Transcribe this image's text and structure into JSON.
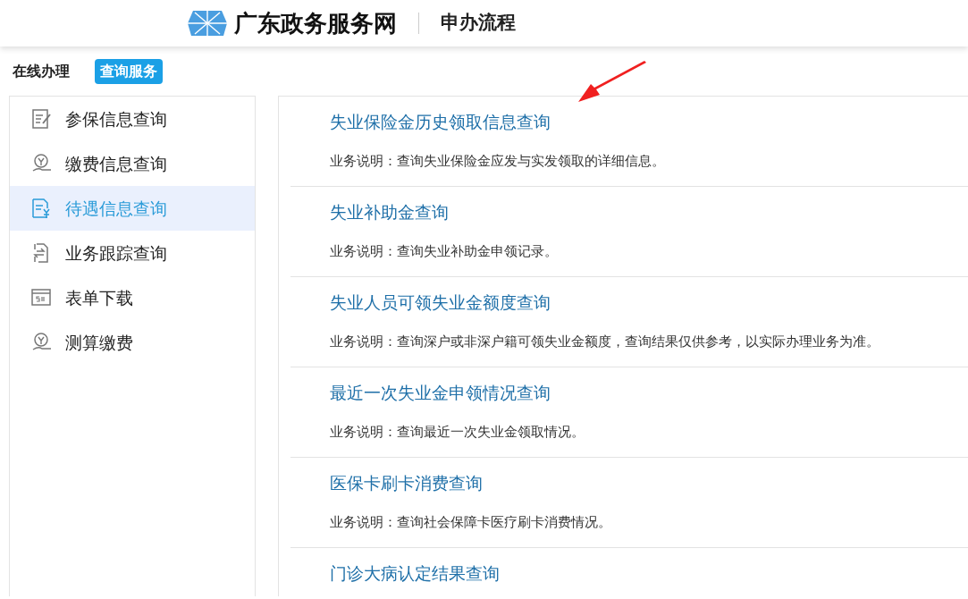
{
  "header": {
    "site_name": "广东政务服务网",
    "page_title": "申办流程"
  },
  "tabs": [
    {
      "label": "在线办理",
      "selected": false
    },
    {
      "label": "查询服务",
      "selected": true
    }
  ],
  "sidebar": {
    "items": [
      {
        "label": "参保信息查询",
        "kind": "form",
        "selected": false
      },
      {
        "label": "缴费信息查询",
        "kind": "coin",
        "selected": false
      },
      {
        "label": "待遇信息查询",
        "kind": "yen",
        "selected": true
      },
      {
        "label": "业务跟踪查询",
        "kind": "transfer",
        "selected": false
      },
      {
        "label": "表单下载",
        "kind": "si",
        "selected": false
      },
      {
        "label": "测算缴费",
        "kind": "coin",
        "selected": false
      }
    ]
  },
  "services": [
    {
      "title": "失业保险金历史领取信息查询",
      "description": "业务说明：查询失业保险金应发与实发领取的详细信息。"
    },
    {
      "title": "失业补助金查询",
      "description": "业务说明：查询失业补助金申领记录。"
    },
    {
      "title": "失业人员可领失业金额度查询",
      "description": "业务说明：查询深户或非深户籍可领失业金额度，查询结果仅供参考，以实际办理业务为准。"
    },
    {
      "title": "最近一次失业金申领情况查询",
      "description": "业务说明：查询最近一次失业金领取情况。"
    },
    {
      "title": "医保卡刷卡消费查询",
      "description": "业务说明：查询社会保障卡医疗刷卡消费情况。"
    },
    {
      "title": "门诊大病认定结果查询"
    }
  ]
}
